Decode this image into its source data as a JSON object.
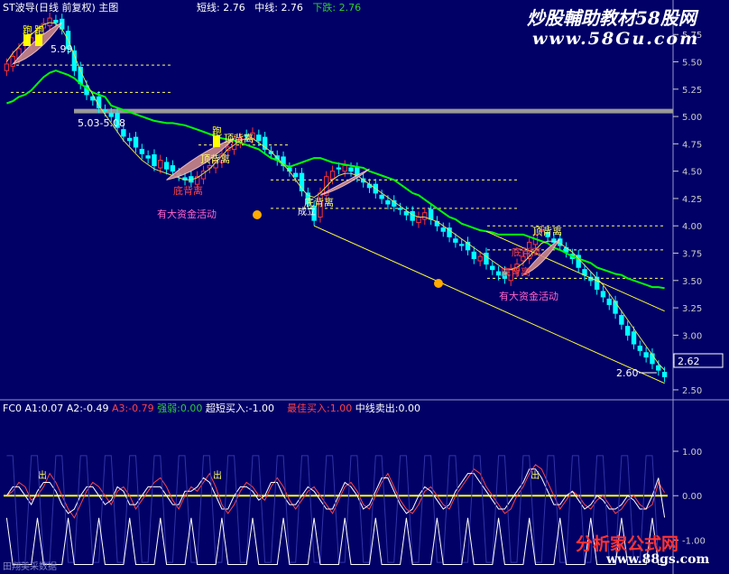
{
  "app": {
    "header_title": "ST波导(日线 前复权) 主图",
    "indicators": [
      {
        "label": "短线:",
        "value": "2.76",
        "color": "#ffffff"
      },
      {
        "label": "中线:",
        "value": "2.76",
        "color": "#ffffff"
      },
      {
        "label": "下跌:",
        "value": "2.76",
        "color": "#33cc33"
      }
    ],
    "watermark_top": "炒股輔助教材58股网",
    "watermark_top_url": "www.58Gu.com",
    "sub_panel": {
      "name": "FC0",
      "items": [
        {
          "label": "A1:",
          "value": "0.07",
          "color": "#ffffff"
        },
        {
          "label": "A2:",
          "value": "-0.49",
          "color": "#ffffff"
        },
        {
          "label": "A3:",
          "value": "-0.79",
          "color": "#ff4444"
        },
        {
          "label": "强弱:",
          "value": "0.00",
          "color": "#33cc33"
        },
        {
          "label": "超短买入:",
          "value": "-1.00",
          "color": "#ffffff"
        },
        {
          "label": "最佳买入:",
          "value": "1.00",
          "color": "#ff4444"
        },
        {
          "label": "中线卖出:",
          "value": "0.00",
          "color": "#ffffff"
        }
      ]
    },
    "watermark_bottom": "分析家公式网",
    "watermark_bottom_url": "www.88gs.com",
    "footer_tag": "田翔美采数据"
  },
  "chart_data": {
    "type": "candlestick",
    "main": {
      "ylim": [
        2.45,
        5.95
      ],
      "y_ticks": [
        "5.75",
        "5.50",
        "5.25",
        "5.00",
        "4.75",
        "4.50",
        "4.25",
        "4.00",
        "3.75",
        "3.50",
        "3.25",
        "3.00",
        "2.75",
        "2.50"
      ],
      "last_price_label": "2.62",
      "annotations": {
        "high_value": "5.99",
        "range_label": "5.03-5.08",
        "low_value": "2.60",
        "top_divergence": [
          "顶背离",
          "顶背离",
          "顶背离"
        ],
        "bottom_divergence": [
          "底背离",
          "底背离",
          "底背离",
          "底背离"
        ],
        "fund_activity": [
          "有大资金活动",
          "有大资金活动"
        ],
        "run_signal": [
          "跑",
          "跑",
          "跑"
        ],
        "misc": [
          "成立"
        ]
      },
      "colors": {
        "up": "#ff3333",
        "down": "#00ffff",
        "short_line": "#00ff00",
        "mid_line": "#ffff66",
        "trend": "#ffff33"
      },
      "closes": [
        5.48,
        5.55,
        5.62,
        5.68,
        5.72,
        5.78,
        5.85,
        5.9,
        5.86,
        5.8,
        5.62,
        5.42,
        5.3,
        5.2,
        5.15,
        5.08,
        5.05,
        5.0,
        4.9,
        4.82,
        4.78,
        4.72,
        4.66,
        4.62,
        4.55,
        4.6,
        4.52,
        4.5,
        4.46,
        4.42,
        4.4,
        4.45,
        4.5,
        4.55,
        4.6,
        4.66,
        4.72,
        4.78,
        4.8,
        4.82,
        4.85,
        4.78,
        4.7,
        4.66,
        4.6,
        4.55,
        4.5,
        4.45,
        4.32,
        4.2,
        4.05,
        4.3,
        4.45,
        4.5,
        4.52,
        4.55,
        4.5,
        4.45,
        4.4,
        4.35,
        4.3,
        4.25,
        4.2,
        4.18,
        4.15,
        4.1,
        4.05,
        4.08,
        4.12,
        4.06,
        4.0,
        3.95,
        3.9,
        3.85,
        3.82,
        3.78,
        3.7,
        3.72,
        3.65,
        3.6,
        3.55,
        3.52,
        3.6,
        3.65,
        3.72,
        3.85,
        3.92,
        3.96,
        3.9,
        3.85,
        3.82,
        3.76,
        3.7,
        3.62,
        3.55,
        3.5,
        3.42,
        3.35,
        3.28,
        3.2,
        3.1,
        3.0,
        2.92,
        2.86,
        2.8,
        2.74,
        2.68,
        2.62
      ],
      "short_line": [
        5.12,
        5.14,
        5.18,
        5.2,
        5.24,
        5.3,
        5.36,
        5.4,
        5.42,
        5.4,
        5.38,
        5.35,
        5.3,
        5.26,
        5.22,
        5.2,
        5.18,
        5.1,
        5.08,
        5.06,
        5.04,
        5.02,
        5.0,
        4.98,
        4.96,
        4.95,
        4.94,
        4.94,
        4.93,
        4.92,
        4.9,
        4.88,
        4.86,
        4.84,
        4.82,
        4.8,
        4.79,
        4.78,
        4.76,
        4.74,
        4.72,
        4.7,
        4.66,
        4.62,
        4.6,
        4.56,
        4.54,
        4.56,
        4.58,
        4.6,
        4.62,
        4.62,
        4.6,
        4.58,
        4.57,
        4.56,
        4.55,
        4.54,
        4.53,
        4.5,
        4.48,
        4.46,
        4.44,
        4.42,
        4.38,
        4.34,
        4.3,
        4.28,
        4.24,
        4.2,
        4.16,
        4.12,
        4.08,
        4.06,
        4.02,
        4.0,
        3.98,
        3.96,
        3.95,
        3.94,
        3.92,
        3.92,
        3.92,
        3.92,
        3.92,
        3.9,
        3.88,
        3.86,
        3.84,
        3.8,
        3.78,
        3.75,
        3.72,
        3.7,
        3.68,
        3.66,
        3.62,
        3.6,
        3.58,
        3.56,
        3.55,
        3.52,
        3.5,
        3.48,
        3.46,
        3.44,
        3.44,
        3.43
      ],
      "mid_line": [
        5.5,
        5.58,
        5.64,
        5.7,
        5.75,
        5.8,
        5.84,
        5.86,
        5.85,
        5.8,
        5.7,
        5.56,
        5.42,
        5.3,
        5.2,
        5.1,
        5.02,
        4.94,
        4.86,
        4.78,
        4.72,
        4.66,
        4.6,
        4.56,
        4.52,
        4.5,
        4.48,
        4.46,
        4.44,
        4.42,
        4.42,
        4.44,
        4.48,
        4.52,
        4.58,
        4.64,
        4.7,
        4.74,
        4.78,
        4.8,
        4.8,
        4.76,
        4.72,
        4.68,
        4.62,
        4.56,
        4.5,
        4.42,
        4.34,
        4.28,
        4.26,
        4.3,
        4.36,
        4.42,
        4.46,
        4.48,
        4.48,
        4.46,
        4.42,
        4.38,
        4.34,
        4.3,
        4.26,
        4.22,
        4.18,
        4.14,
        4.1,
        4.08,
        4.08,
        4.06,
        4.04,
        4.0,
        3.96,
        3.92,
        3.88,
        3.84,
        3.8,
        3.76,
        3.72,
        3.68,
        3.64,
        3.6,
        3.6,
        3.62,
        3.66,
        3.72,
        3.78,
        3.84,
        3.86,
        3.86,
        3.84,
        3.8,
        3.76,
        3.7,
        3.64,
        3.58,
        3.52,
        3.46,
        3.38,
        3.3,
        3.22,
        3.14,
        3.06,
        2.98,
        2.9,
        2.82,
        2.74,
        2.68
      ],
      "trend_lines": [
        {
          "from": [
            50,
            4.0
          ],
          "to": [
            107,
            2.56
          ]
        },
        {
          "from": [
            78,
            3.95
          ],
          "to": [
            107,
            3.22
          ]
        }
      ]
    },
    "sub": {
      "ylim": [
        -1.6,
        1.0
      ],
      "y_ticks": [
        "1.00",
        "0.00",
        "-1.00"
      ],
      "a1": [
        0.0,
        0.1,
        0.3,
        0.2,
        -0.1,
        0.0,
        0.2,
        0.5,
        0.3,
        0.0,
        -0.3,
        -0.5,
        -0.2,
        0.1,
        0.3,
        0.2,
        0.0,
        -0.2,
        0.1,
        0.2,
        0.0,
        -0.3,
        -0.1,
        0.1,
        0.3,
        0.4,
        0.2,
        -0.1,
        -0.3,
        0.0,
        0.2,
        0.1,
        0.3,
        0.5,
        0.2,
        -0.2,
        -0.4,
        -0.2,
        0.1,
        0.3,
        0.2,
        0.0,
        -0.1,
        0.2,
        0.4,
        0.2,
        -0.1,
        -0.3,
        -0.1,
        0.1,
        0.2,
        0.0,
        -0.2,
        -0.4,
        -0.1,
        0.2,
        0.3,
        0.1,
        -0.2,
        -0.3,
        0.0,
        0.3,
        0.5,
        0.2,
        -0.1,
        -0.3,
        -0.4,
        -0.2,
        0.1,
        0.2,
        0.0,
        -0.2,
        -0.3,
        0.0,
        0.2,
        0.4,
        0.6,
        0.5,
        0.2,
        0.0,
        -0.2,
        -0.4,
        -0.3,
        0.0,
        0.2,
        0.5,
        0.7,
        0.6,
        0.3,
        0.0,
        -0.3,
        -0.1,
        0.1,
        0.0,
        -0.2,
        -0.3,
        -0.1,
        0.0,
        -0.2,
        -0.4,
        -0.3,
        -0.1,
        0.0,
        -0.2,
        -0.3,
        -0.2,
        0.3,
        0.07
      ],
      "a2": [
        0.0,
        0.2,
        0.2,
        0.0,
        -0.2,
        0.1,
        0.3,
        0.3,
        0.1,
        -0.2,
        -0.4,
        -0.3,
        0.0,
        0.2,
        0.2,
        0.0,
        -0.2,
        -0.1,
        0.2,
        0.1,
        -0.2,
        -0.2,
        0.0,
        0.2,
        0.2,
        0.2,
        0.0,
        -0.2,
        -0.2,
        0.1,
        0.1,
        0.2,
        0.4,
        0.3,
        0.0,
        -0.3,
        -0.3,
        0.0,
        0.2,
        0.2,
        0.1,
        -0.1,
        0.0,
        0.3,
        0.3,
        0.0,
        -0.2,
        -0.2,
        0.0,
        0.2,
        0.1,
        -0.1,
        -0.3,
        -0.3,
        0.0,
        0.3,
        0.2,
        0.0,
        -0.3,
        -0.2,
        0.1,
        0.4,
        0.4,
        0.1,
        -0.2,
        -0.4,
        -0.3,
        0.0,
        0.2,
        0.1,
        -0.1,
        -0.3,
        -0.2,
        0.1,
        0.3,
        0.5,
        0.5,
        0.3,
        0.1,
        -0.1,
        -0.3,
        -0.3,
        -0.1,
        0.1,
        0.3,
        0.6,
        0.6,
        0.4,
        0.1,
        -0.2,
        -0.2,
        0.0,
        0.1,
        -0.1,
        -0.3,
        -0.2,
        0.0,
        -0.1,
        -0.3,
        -0.3,
        -0.2,
        0.0,
        -0.1,
        -0.3,
        -0.3,
        0.0,
        0.4,
        -0.49
      ]
    }
  }
}
